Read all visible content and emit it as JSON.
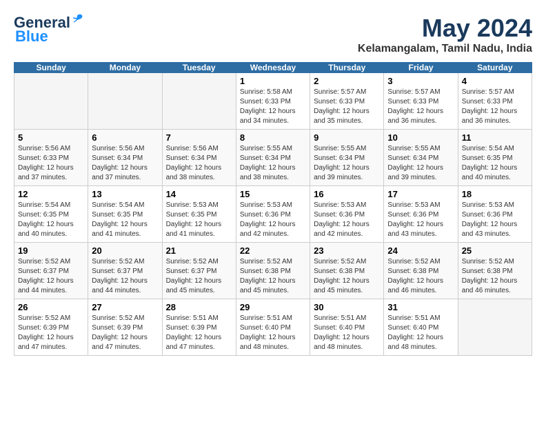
{
  "header": {
    "logo_general": "General",
    "logo_blue": "Blue",
    "month_title": "May 2024",
    "location": "Kelamangalam, Tamil Nadu, India"
  },
  "days_of_week": [
    "Sunday",
    "Monday",
    "Tuesday",
    "Wednesday",
    "Thursday",
    "Friday",
    "Saturday"
  ],
  "weeks": [
    [
      {
        "date": "",
        "info": ""
      },
      {
        "date": "",
        "info": ""
      },
      {
        "date": "",
        "info": ""
      },
      {
        "date": "1",
        "info": "Sunrise: 5:58 AM\nSunset: 6:33 PM\nDaylight: 12 hours\nand 34 minutes."
      },
      {
        "date": "2",
        "info": "Sunrise: 5:57 AM\nSunset: 6:33 PM\nDaylight: 12 hours\nand 35 minutes."
      },
      {
        "date": "3",
        "info": "Sunrise: 5:57 AM\nSunset: 6:33 PM\nDaylight: 12 hours\nand 36 minutes."
      },
      {
        "date": "4",
        "info": "Sunrise: 5:57 AM\nSunset: 6:33 PM\nDaylight: 12 hours\nand 36 minutes."
      }
    ],
    [
      {
        "date": "5",
        "info": "Sunrise: 5:56 AM\nSunset: 6:33 PM\nDaylight: 12 hours\nand 37 minutes."
      },
      {
        "date": "6",
        "info": "Sunrise: 5:56 AM\nSunset: 6:34 PM\nDaylight: 12 hours\nand 37 minutes."
      },
      {
        "date": "7",
        "info": "Sunrise: 5:56 AM\nSunset: 6:34 PM\nDaylight: 12 hours\nand 38 minutes."
      },
      {
        "date": "8",
        "info": "Sunrise: 5:55 AM\nSunset: 6:34 PM\nDaylight: 12 hours\nand 38 minutes."
      },
      {
        "date": "9",
        "info": "Sunrise: 5:55 AM\nSunset: 6:34 PM\nDaylight: 12 hours\nand 39 minutes."
      },
      {
        "date": "10",
        "info": "Sunrise: 5:55 AM\nSunset: 6:34 PM\nDaylight: 12 hours\nand 39 minutes."
      },
      {
        "date": "11",
        "info": "Sunrise: 5:54 AM\nSunset: 6:35 PM\nDaylight: 12 hours\nand 40 minutes."
      }
    ],
    [
      {
        "date": "12",
        "info": "Sunrise: 5:54 AM\nSunset: 6:35 PM\nDaylight: 12 hours\nand 40 minutes."
      },
      {
        "date": "13",
        "info": "Sunrise: 5:54 AM\nSunset: 6:35 PM\nDaylight: 12 hours\nand 41 minutes."
      },
      {
        "date": "14",
        "info": "Sunrise: 5:53 AM\nSunset: 6:35 PM\nDaylight: 12 hours\nand 41 minutes."
      },
      {
        "date": "15",
        "info": "Sunrise: 5:53 AM\nSunset: 6:36 PM\nDaylight: 12 hours\nand 42 minutes."
      },
      {
        "date": "16",
        "info": "Sunrise: 5:53 AM\nSunset: 6:36 PM\nDaylight: 12 hours\nand 42 minutes."
      },
      {
        "date": "17",
        "info": "Sunrise: 5:53 AM\nSunset: 6:36 PM\nDaylight: 12 hours\nand 43 minutes."
      },
      {
        "date": "18",
        "info": "Sunrise: 5:53 AM\nSunset: 6:36 PM\nDaylight: 12 hours\nand 43 minutes."
      }
    ],
    [
      {
        "date": "19",
        "info": "Sunrise: 5:52 AM\nSunset: 6:37 PM\nDaylight: 12 hours\nand 44 minutes."
      },
      {
        "date": "20",
        "info": "Sunrise: 5:52 AM\nSunset: 6:37 PM\nDaylight: 12 hours\nand 44 minutes."
      },
      {
        "date": "21",
        "info": "Sunrise: 5:52 AM\nSunset: 6:37 PM\nDaylight: 12 hours\nand 45 minutes."
      },
      {
        "date": "22",
        "info": "Sunrise: 5:52 AM\nSunset: 6:38 PM\nDaylight: 12 hours\nand 45 minutes."
      },
      {
        "date": "23",
        "info": "Sunrise: 5:52 AM\nSunset: 6:38 PM\nDaylight: 12 hours\nand 45 minutes."
      },
      {
        "date": "24",
        "info": "Sunrise: 5:52 AM\nSunset: 6:38 PM\nDaylight: 12 hours\nand 46 minutes."
      },
      {
        "date": "25",
        "info": "Sunrise: 5:52 AM\nSunset: 6:38 PM\nDaylight: 12 hours\nand 46 minutes."
      }
    ],
    [
      {
        "date": "26",
        "info": "Sunrise: 5:52 AM\nSunset: 6:39 PM\nDaylight: 12 hours\nand 47 minutes."
      },
      {
        "date": "27",
        "info": "Sunrise: 5:52 AM\nSunset: 6:39 PM\nDaylight: 12 hours\nand 47 minutes."
      },
      {
        "date": "28",
        "info": "Sunrise: 5:51 AM\nSunset: 6:39 PM\nDaylight: 12 hours\nand 47 minutes."
      },
      {
        "date": "29",
        "info": "Sunrise: 5:51 AM\nSunset: 6:40 PM\nDaylight: 12 hours\nand 48 minutes."
      },
      {
        "date": "30",
        "info": "Sunrise: 5:51 AM\nSunset: 6:40 PM\nDaylight: 12 hours\nand 48 minutes."
      },
      {
        "date": "31",
        "info": "Sunrise: 5:51 AM\nSunset: 6:40 PM\nDaylight: 12 hours\nand 48 minutes."
      },
      {
        "date": "",
        "info": ""
      }
    ]
  ]
}
